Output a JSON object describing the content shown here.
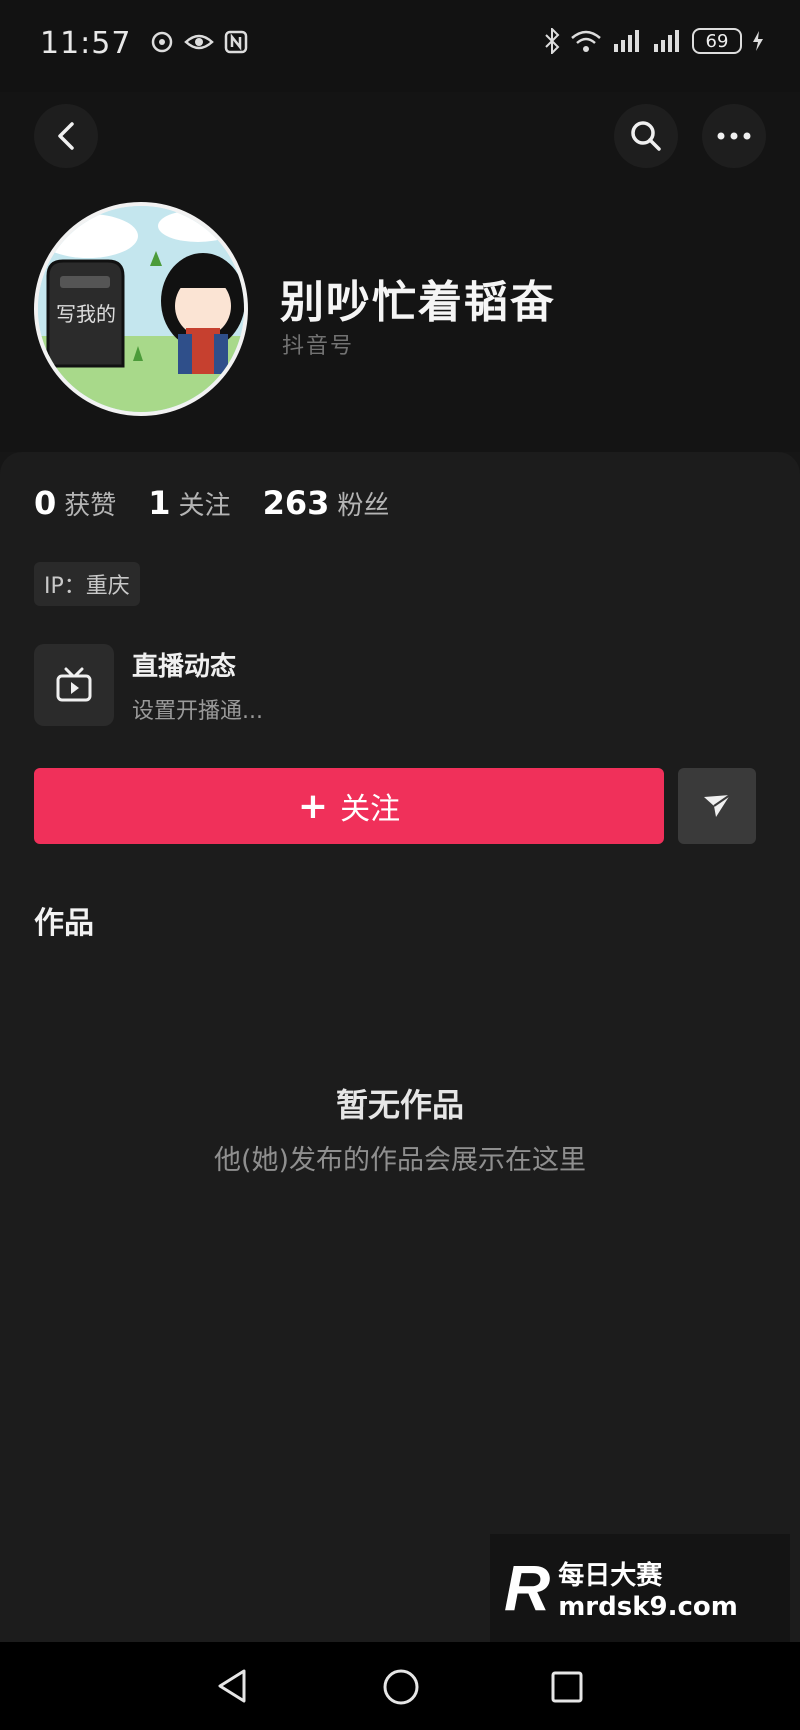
{
  "status_bar": {
    "time": "11:57",
    "battery": "69"
  },
  "profile": {
    "name": "别吵忙着韬奋",
    "subtitle": "抖音号",
    "avatar_text": "写我的"
  },
  "stats": [
    {
      "num": "0",
      "label": "获赞"
    },
    {
      "num": "1",
      "label": "关注"
    },
    {
      "num": "263",
      "label": "粉丝"
    }
  ],
  "ip": "IP：重庆",
  "live": {
    "title": "直播动态",
    "desc": "设置开播通..."
  },
  "actions": {
    "follow_label": "关注"
  },
  "works": {
    "tab_label": "作品",
    "empty_title": "暂无作品",
    "empty_desc": "他(她)发布的作品会展示在这里"
  },
  "watermark": {
    "brand": "每日大赛",
    "domain": "mrdsk9.com",
    "logo": "R"
  },
  "colors": {
    "accent": "#f0305a",
    "background": "#1c1c1c"
  }
}
